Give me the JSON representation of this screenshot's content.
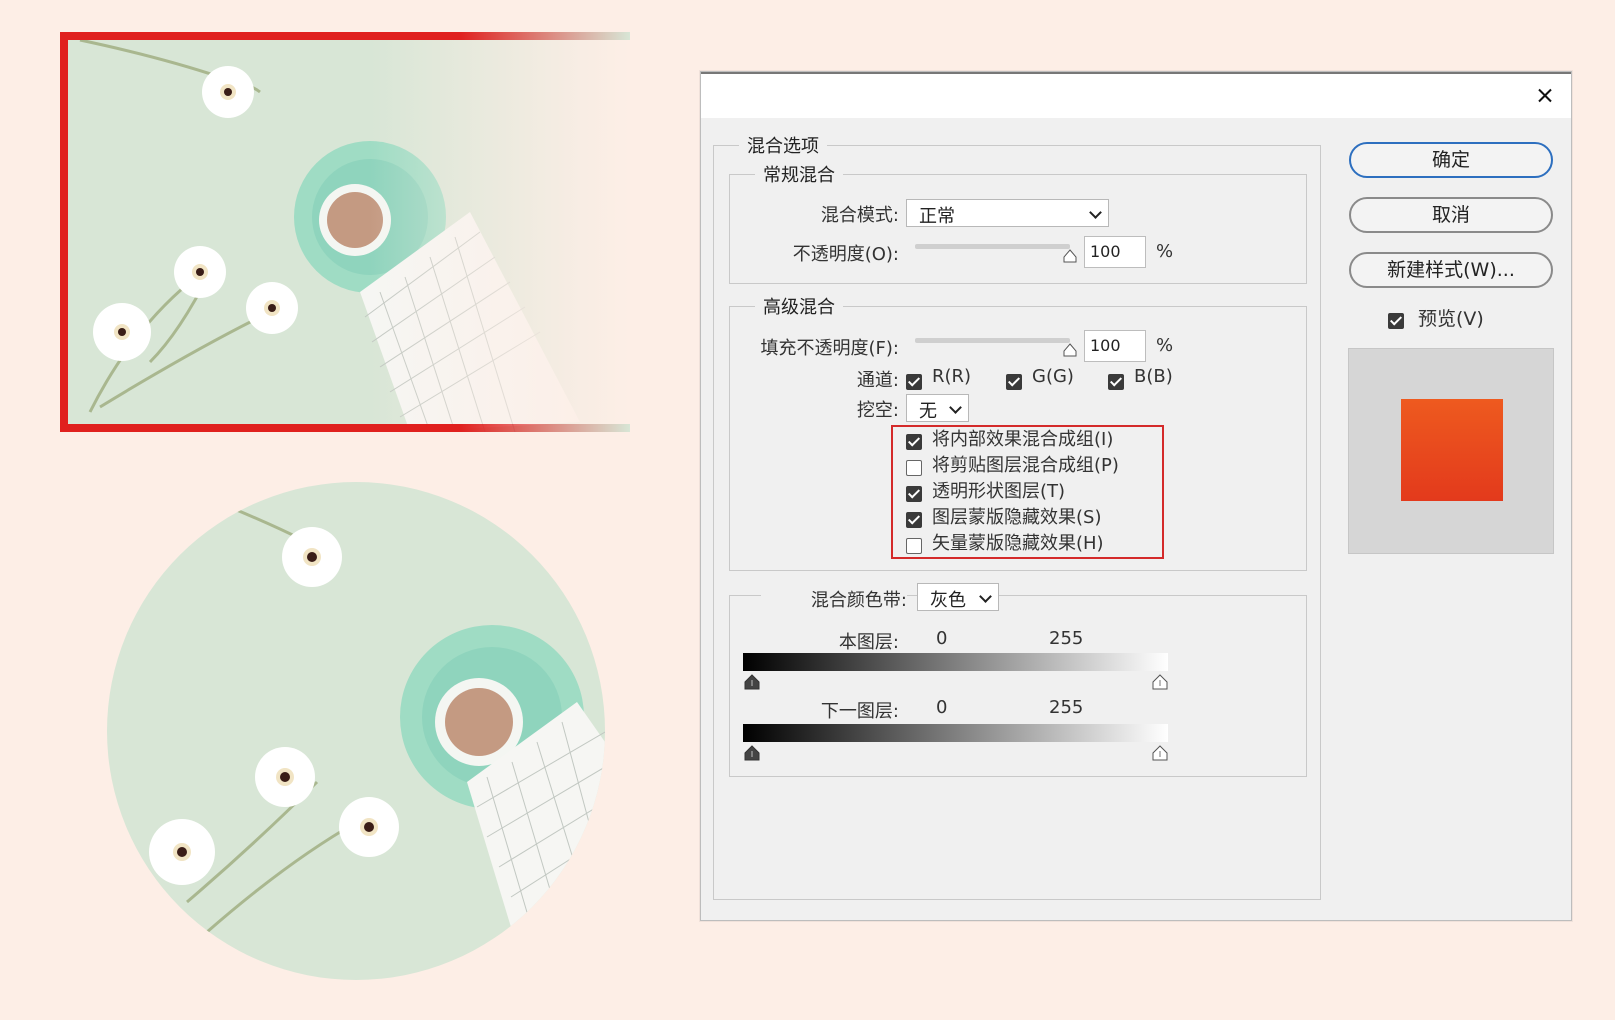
{
  "dialog": {
    "close_label": "×",
    "blend_options_title": "混合选项",
    "general": {
      "title": "常规混合",
      "mode_label": "混合模式:",
      "mode_value": "正常",
      "opacity_label": "不透明度(O):",
      "opacity_value": "100",
      "opacity_unit": "%",
      "opacity_level": 1.0
    },
    "advanced": {
      "title": "高级混合",
      "fill_label": "填充不透明度(F):",
      "fill_value": "100",
      "fill_unit": "%",
      "fill_level": 1.0,
      "channels_label": "通道:",
      "channels": [
        {
          "label": "R(R)",
          "checked": true
        },
        {
          "label": "G(G)",
          "checked": true
        },
        {
          "label": "B(B)",
          "checked": true
        }
      ],
      "knockout_label": "挖空:",
      "knockout_value": "无",
      "options": [
        {
          "label": "将内部效果混合成组(I)",
          "checked": true
        },
        {
          "label": "将剪贴图层混合成组(P)",
          "checked": false
        },
        {
          "label": "透明形状图层(T)",
          "checked": true
        },
        {
          "label": "图层蒙版隐藏效果(S)",
          "checked": true
        },
        {
          "label": "矢量蒙版隐藏效果(H)",
          "checked": false
        }
      ],
      "highlight_color": "#d42a2a"
    },
    "blend_if": {
      "label": "混合颜色带:",
      "value": "灰色",
      "this_layer_label": "本图层:",
      "this_layer_low": "0",
      "this_layer_high": "255",
      "underlying_label": "下一图层:",
      "underlying_low": "0",
      "underlying_high": "255"
    },
    "buttons": {
      "ok": "确定",
      "cancel": "取消",
      "new_style": "新建样式(W)..."
    },
    "preview_label": "预览(V)",
    "preview_checked": true,
    "preview_swatch_colors": [
      "#ee5a1f",
      "#e33a1c"
    ],
    "primary_button_color": "#2d6fbf"
  },
  "illustration": {
    "frame_color": "#e0201e",
    "background_color": "#d8e6d6",
    "cup_color": "#8fd4bd",
    "coffee_color": "#c49a82"
  }
}
